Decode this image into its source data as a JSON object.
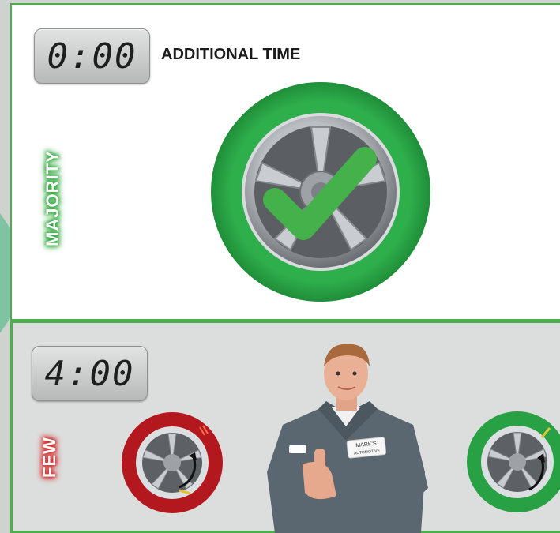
{
  "majority": {
    "timer": "0:00",
    "title": "ADDITIONAL TIME",
    "label": "MAJORITY"
  },
  "few": {
    "timer": "4:00",
    "label": "FEW"
  },
  "badge": {
    "line1": "MARK'S",
    "line2": "AUTOMOTIVE"
  },
  "colors": {
    "accent_green": "#2ea848",
    "tire_green": "#27a143",
    "tire_red": "#b3181f",
    "frame_green": "#4cae4f",
    "arrow": "#7fc3a3"
  },
  "icons": [
    "checkmark-icon",
    "wheel-icon",
    "rotate-arrow-icon"
  ]
}
